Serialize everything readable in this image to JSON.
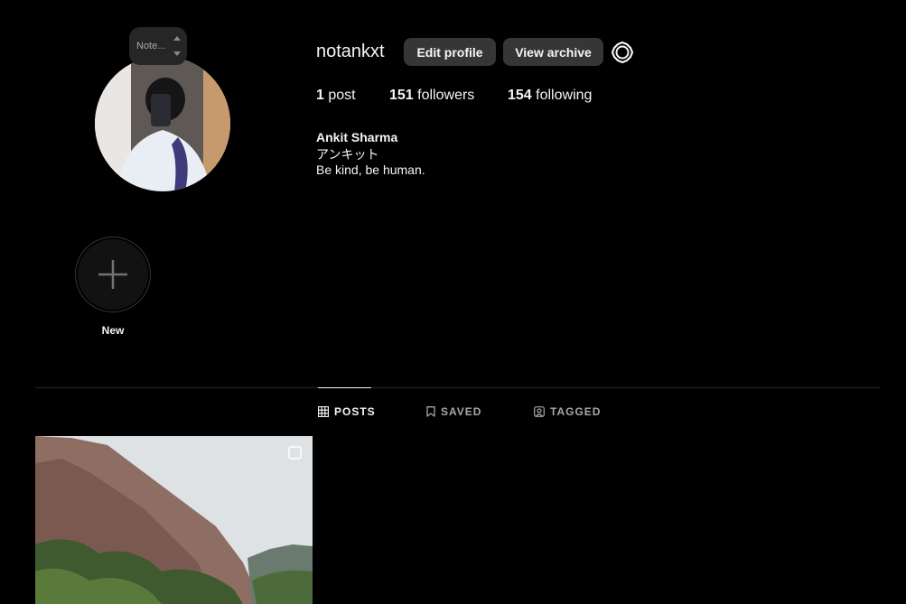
{
  "profile": {
    "username": "notankxt",
    "note_placeholder": "Note...",
    "edit_profile_label": "Edit profile",
    "view_archive_label": "View archive",
    "settings_icon": "gear-icon"
  },
  "stats": {
    "posts_count": "1",
    "posts_label": "post",
    "followers_count": "151",
    "followers_label": "followers",
    "following_count": "154",
    "following_label": "following"
  },
  "bio": {
    "name": "Ankit Sharma",
    "alias": "アンキット",
    "text": "Be kind, be human."
  },
  "highlights": {
    "new_label": "New",
    "new_icon": "plus-icon"
  },
  "tabs": [
    {
      "label": "POSTS",
      "icon": "grid-icon",
      "active": true
    },
    {
      "label": "SAVED",
      "icon": "bookmark-icon",
      "active": false
    },
    {
      "label": "TAGGED",
      "icon": "tagged-user-icon",
      "active": false
    }
  ],
  "posts": [
    {
      "type": "image",
      "subject": "cliff-landscape",
      "multi": true
    }
  ],
  "colors": {
    "background": "#000000",
    "button_bg": "#363636",
    "text": "#f5f5f5",
    "muted": "#a8a8a8",
    "divider": "#262626"
  }
}
